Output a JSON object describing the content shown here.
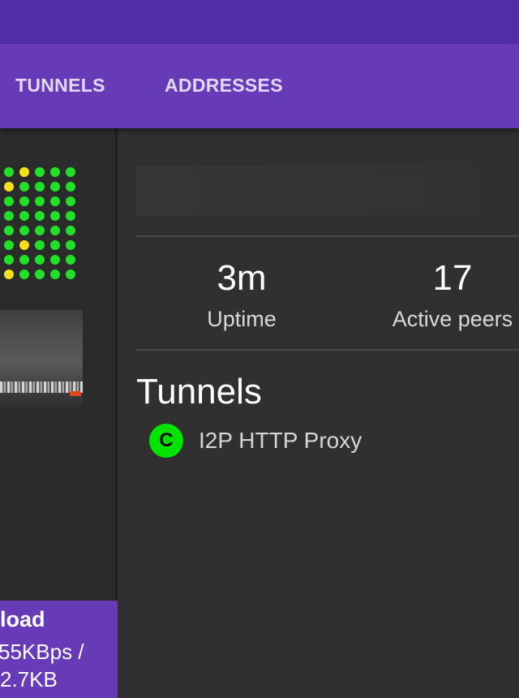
{
  "tabs": [
    {
      "label": "TUNNELS"
    },
    {
      "label": "ADDRESSES"
    }
  ],
  "left_pane": {
    "dot_matrix": {
      "colors": [
        "#22e02a",
        "#f5e11a"
      ],
      "rows": [
        [
          "g",
          "y",
          "g",
          "g",
          "g"
        ],
        [
          "y",
          "g",
          "g",
          "g",
          "g"
        ],
        [
          "g",
          "g",
          "g",
          "g",
          "g"
        ],
        [
          "g",
          "g",
          "g",
          "g",
          "g"
        ],
        [
          "g",
          "g",
          "g",
          "g",
          "g"
        ],
        [
          "g",
          "y",
          "g",
          "g",
          "g"
        ],
        [
          "g",
          "g",
          "g",
          "g",
          "g"
        ],
        [
          "y",
          "g",
          "g",
          "g",
          "g"
        ]
      ]
    },
    "card": {
      "title": "load",
      "line1": "55KBps /",
      "line2": "2.7KB"
    }
  },
  "stats": [
    {
      "value": "3m",
      "label": "Uptime"
    },
    {
      "value": "17",
      "label": "Active peers"
    }
  ],
  "tunnels_section": {
    "title": "Tunnels",
    "items": [
      {
        "badge": "C",
        "name": "I2P HTTP Proxy",
        "status_color": "#00e400"
      }
    ]
  }
}
